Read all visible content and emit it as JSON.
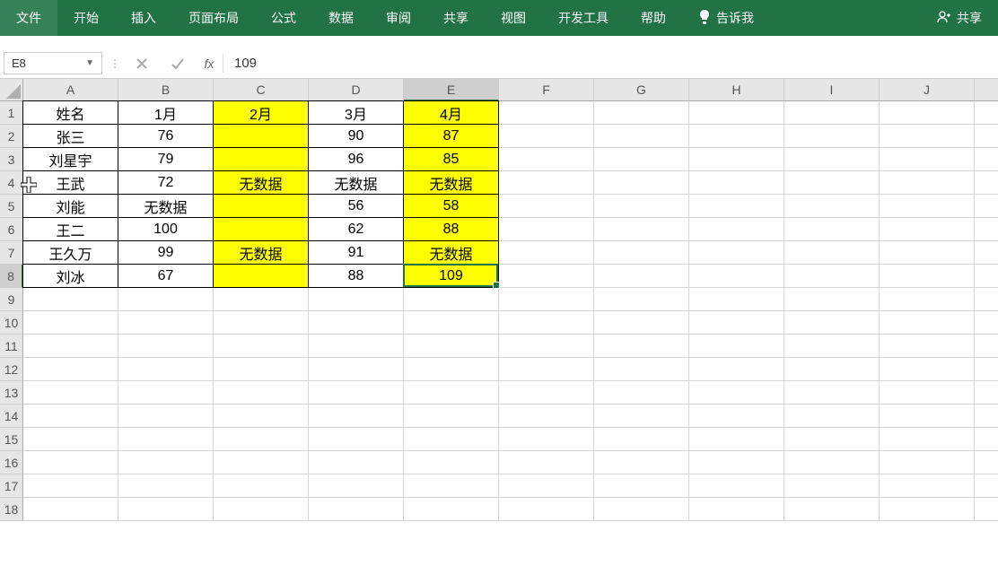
{
  "ribbon": {
    "tabs": [
      "文件",
      "开始",
      "插入",
      "页面布局",
      "公式",
      "数据",
      "审阅",
      "共享",
      "视图",
      "开发工具",
      "帮助"
    ],
    "tellme": "告诉我",
    "share": "共享"
  },
  "formula_bar": {
    "cell_ref": "E8",
    "value": "109",
    "fx_label": "fx"
  },
  "grid": {
    "cols": [
      "A",
      "B",
      "C",
      "D",
      "E",
      "F",
      "G",
      "H",
      "I",
      "J"
    ],
    "rows": [
      1,
      2,
      3,
      4,
      5,
      6,
      7,
      8,
      9,
      10,
      11,
      12,
      13,
      14,
      15,
      16,
      17,
      18
    ],
    "data": [
      [
        "姓名",
        "1月",
        "2月",
        "3月",
        "4月"
      ],
      [
        "张三",
        "76",
        "",
        "90",
        "87"
      ],
      [
        "刘星宇",
        "79",
        "",
        "96",
        "85"
      ],
      [
        "王武",
        "72",
        "无数据",
        "无数据",
        "无数据"
      ],
      [
        "刘能",
        "无数据",
        "",
        "56",
        "58"
      ],
      [
        "王二",
        "100",
        "",
        "62",
        "88"
      ],
      [
        "王久万",
        "99",
        "无数据",
        "91",
        "无数据"
      ],
      [
        "刘冰",
        "67",
        "",
        "88",
        "109"
      ]
    ],
    "yellow_cols": [
      2,
      4
    ],
    "active": {
      "row": 8,
      "col": 5
    }
  }
}
